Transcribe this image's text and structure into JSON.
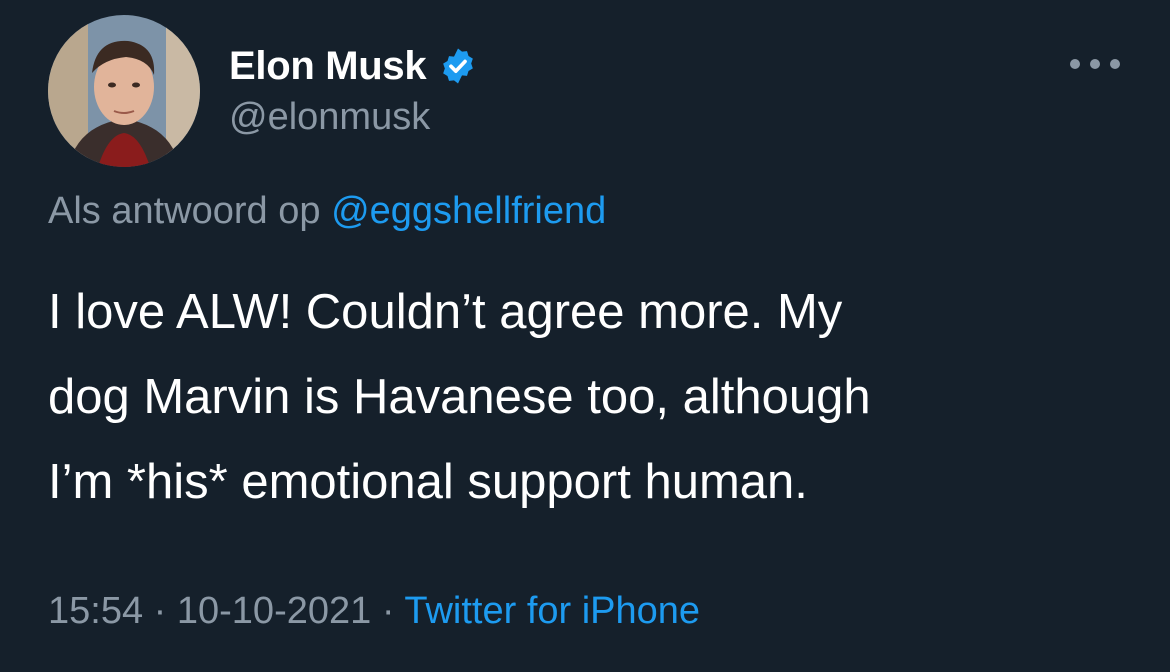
{
  "author": {
    "name": "Elon Musk",
    "handle": "@elonmusk",
    "verified": true
  },
  "reply": {
    "prefix": "Als antwoord op",
    "mention": "@eggshellfriend"
  },
  "tweet": {
    "lines": [
      "I love ALW! Couldn’t agree more. My",
      "dog Marvin is Havanese too, although",
      "I’m *his* emotional support human."
    ]
  },
  "meta": {
    "time": "15:54",
    "separator": "·",
    "date": "10-10-2021",
    "source": "Twitter for iPhone"
  },
  "icons": {
    "verified": "verified-badge-icon",
    "more": "more-options-icon"
  },
  "colors": {
    "background": "#15202b",
    "text": "#ffffff",
    "secondary": "#8b98a5",
    "accent": "#1d9bf0"
  }
}
